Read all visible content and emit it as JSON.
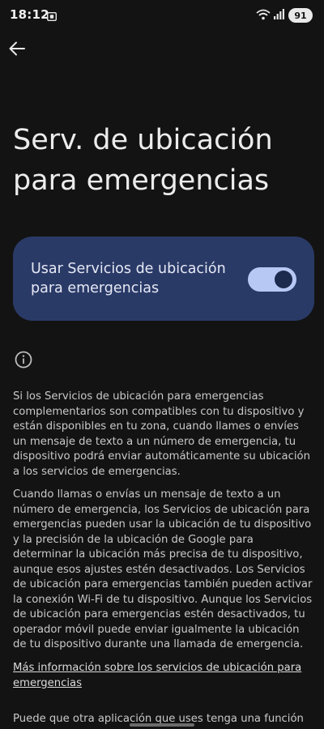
{
  "status_bar": {
    "time": "18:12",
    "battery": "91"
  },
  "header": {
    "back_icon": "arrow-back-icon",
    "title": "Serv. de ubicación para emergencias"
  },
  "toggle": {
    "label": "Usar Servicios de ubicación para emergencias",
    "state": "on"
  },
  "info": {
    "icon": "info-icon",
    "paragraph_1": "Si los Servicios de ubicación para emergencias complementarios son compatibles con tu dispositivo y están disponibles en tu zona, cuando llames o envíes un mensaje de texto a un número de emergencia, tu dispositivo podrá enviar automáticamente su ubicación a los servicios de emergencias.",
    "paragraph_2": "Cuando llamas o envías un mensaje de texto a un número de emergencia, los Servicios de ubicación para emergencias pueden usar la ubicación de tu dispositivo y la precisión de la ubicación de Google para determinar la ubicación más precisa de tu dispositivo, aunque esos ajustes estén desactivados. Los Servicios de ubicación para emergencias también pueden activar la conexión Wi-Fi de tu dispositivo. Aunque los Servicios de ubicación para emergencias estén desactivados, tu operador móvil puede enviar igualmente la ubicación de tu dispositivo durante una llamada de emergencia.",
    "link_label": "Más información sobre los servicios de ubicación para emergencias",
    "paragraph_3": "Puede que otra aplicación que uses tenga una función que"
  },
  "colors": {
    "background": "#131313",
    "card": "#2a3a67",
    "switch_track": "#b7c8f5",
    "switch_thumb": "#1c2a4e"
  }
}
